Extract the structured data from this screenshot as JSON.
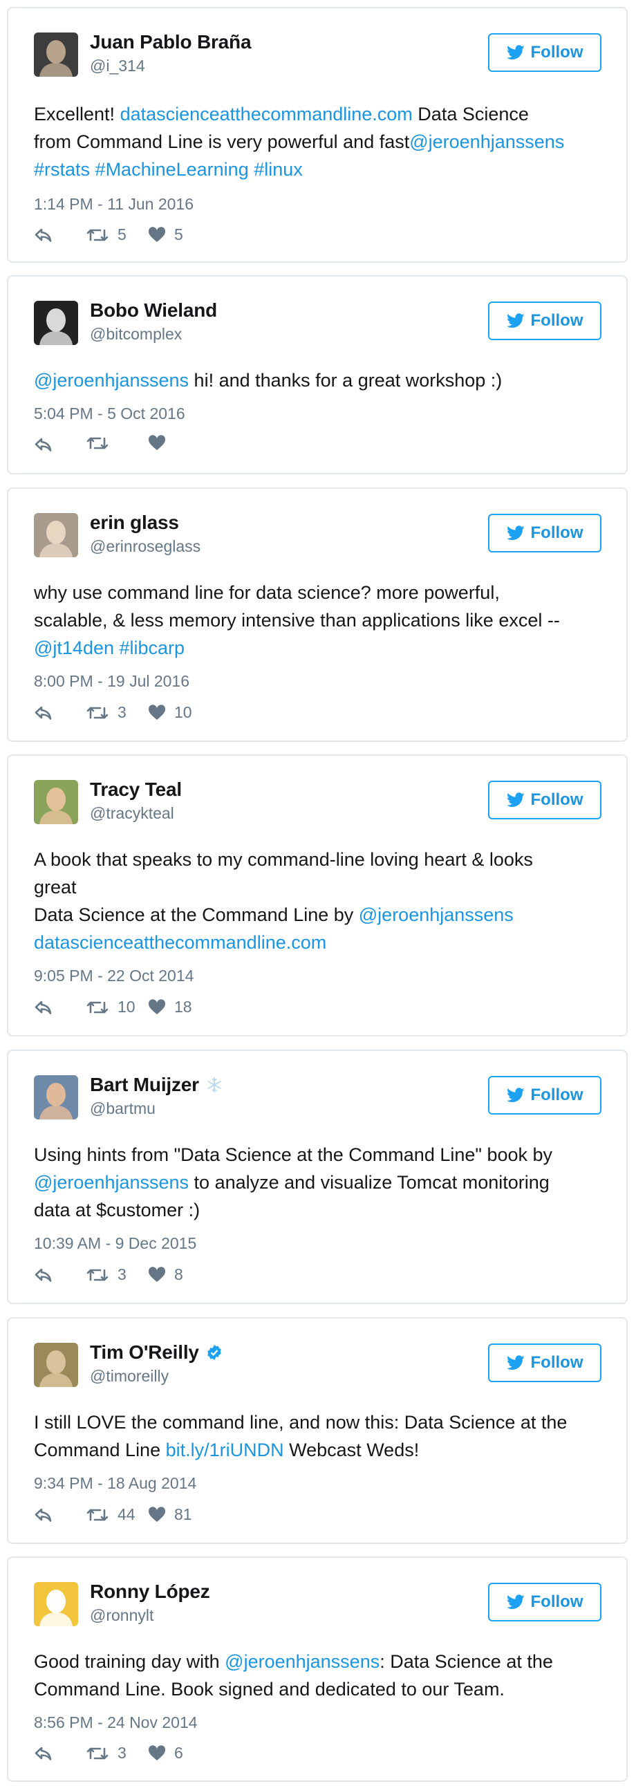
{
  "follow_label": "Follow",
  "colors": {
    "link": "#1b95e0",
    "border": "#e1e8ed",
    "muted": "#657786",
    "verified": "#1da1f2"
  },
  "tweets": [
    {
      "name": "Juan Pablo Braña",
      "handle": "@i_314",
      "segments": [
        {
          "t": "Excellent! ",
          "link": false
        },
        {
          "t": "datascienceatthecommandline.com",
          "link": true
        },
        {
          "t": " Data Science\nfrom Command Line is very powerful and fast",
          "link": false
        },
        {
          "t": "@jeroenhjanssens",
          "link": true
        },
        {
          "t": "\n",
          "link": false
        },
        {
          "t": "#rstats",
          "link": true
        },
        {
          "t": " ",
          "link": false
        },
        {
          "t": "#MachineLearning",
          "link": true
        },
        {
          "t": " ",
          "link": false
        },
        {
          "t": "#linux",
          "link": true
        }
      ],
      "time": "1:14 PM - 11 Jun 2016",
      "retweets": "5",
      "likes": "5",
      "badge": null,
      "avatar_colors": [
        "#3d3d3d",
        "#b8a48c"
      ]
    },
    {
      "name": "Bobo Wieland",
      "handle": "@bitcomplex",
      "segments": [
        {
          "t": "@jeroenhjanssens",
          "link": true
        },
        {
          "t": " hi! and thanks for a great workshop :)",
          "link": false
        }
      ],
      "time": "5:04 PM - 5 Oct 2016",
      "retweets": "",
      "likes": "",
      "badge": null,
      "avatar_colors": [
        "#222222",
        "#d9d9d9"
      ]
    },
    {
      "name": "erin glass",
      "handle": "@erinroseglass",
      "segments": [
        {
          "t": "why use command line for data science? more powerful,\nscalable, & less memory intensive than applications like excel --\n",
          "link": false
        },
        {
          "t": "@jt14den",
          "link": true
        },
        {
          "t": " ",
          "link": false
        },
        {
          "t": "#libcarp",
          "link": true
        }
      ],
      "time": "8:00 PM - 19 Jul 2016",
      "retweets": "3",
      "likes": "10",
      "badge": null,
      "avatar_colors": [
        "#a89a8c",
        "#e8d5c2"
      ]
    },
    {
      "name": "Tracy Teal",
      "handle": "@tracykteal",
      "segments": [
        {
          "t": "A book that speaks to my command-line loving heart & looks\ngreat\nData Science at the Command Line by ",
          "link": false
        },
        {
          "t": "@jeroenhjanssens",
          "link": true
        },
        {
          "t": "\n",
          "link": false
        },
        {
          "t": "datascienceatthecommandline.com",
          "link": true
        }
      ],
      "time": "9:05 PM - 22 Oct 2014",
      "retweets": "10",
      "likes": "18",
      "badge": null,
      "avatar_colors": [
        "#8aa35a",
        "#e2c29a"
      ]
    },
    {
      "name": "Bart Muijzer",
      "handle": "@bartmu",
      "segments": [
        {
          "t": "Using hints from \"Data Science at the Command Line\" book by\n",
          "link": false
        },
        {
          "t": "@jeroenhjanssens",
          "link": true
        },
        {
          "t": " to analyze and visualize Tomcat monitoring\ndata at $customer :)",
          "link": false
        }
      ],
      "time": "10:39 AM - 9 Dec 2015",
      "retweets": "3",
      "likes": "8",
      "badge": "snowflake-icon",
      "avatar_colors": [
        "#6f8aa8",
        "#e0b89a"
      ]
    },
    {
      "name": "Tim O'Reilly",
      "handle": "@timoreilly",
      "segments": [
        {
          "t": "I still LOVE the command line, and now this: Data Science at the\nCommand Line ",
          "link": false
        },
        {
          "t": "bit.ly/1riUNDN",
          "link": true
        },
        {
          "t": " Webcast Weds!",
          "link": false
        }
      ],
      "time": "9:34 PM - 18 Aug 2014",
      "retweets": "44",
      "likes": "81",
      "badge": "verified-icon",
      "avatar_colors": [
        "#9a8a5a",
        "#d9c39d"
      ]
    },
    {
      "name": "Ronny López",
      "handle": "@ronnylt",
      "segments": [
        {
          "t": "Good training day with ",
          "link": false
        },
        {
          "t": "@jeroenhjanssens",
          "link": true
        },
        {
          "t": ": Data Science at the\nCommand Line. Book signed and dedicated to our Team.",
          "link": false
        }
      ],
      "time": "8:56 PM - 24 Nov 2014",
      "retweets": "3",
      "likes": "6",
      "badge": null,
      "avatar_colors": [
        "#f2c53d",
        "#ffffff"
      ]
    }
  ]
}
